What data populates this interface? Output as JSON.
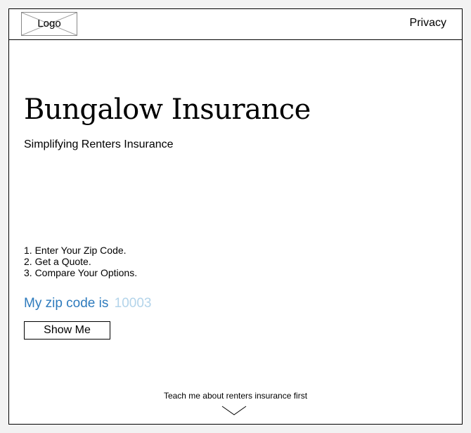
{
  "header": {
    "logo_label": "Logo",
    "privacy_label": "Privacy"
  },
  "hero": {
    "title": "Bungalow Insurance",
    "subtitle": "Simplifying Renters Insurance"
  },
  "steps": [
    "1. Enter Your Zip Code.",
    "2. Get a Quote.",
    "3. Compare Your Options."
  ],
  "zip": {
    "label": "My zip code is",
    "placeholder": "10003",
    "value": ""
  },
  "show_button_label": "Show Me",
  "footer": {
    "teach_label": "Teach me about renters insurance first",
    "chevron_icon": "chevron-down-icon"
  },
  "colors": {
    "accent": "#2e7bbd",
    "placeholder": "#b3d4ea",
    "page_background": "#f2f2f2",
    "frame_background": "#ffffff"
  }
}
